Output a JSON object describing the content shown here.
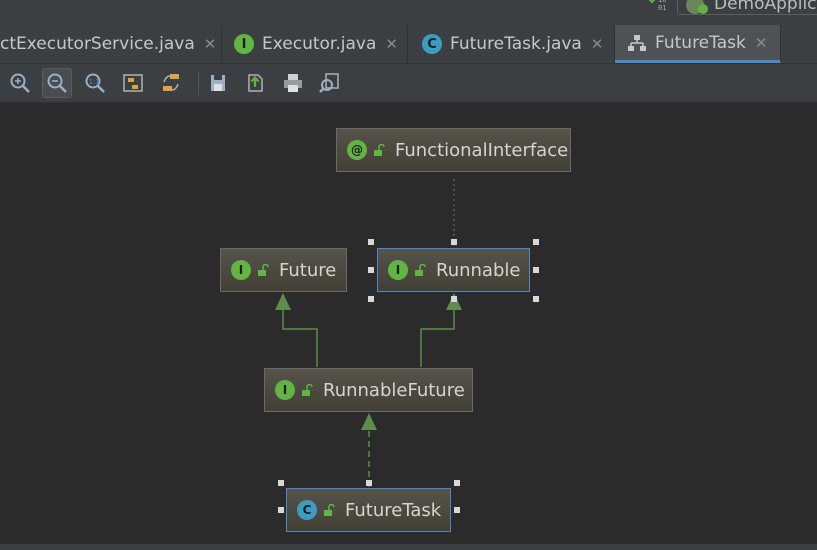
{
  "run_config": {
    "label": "DemoApplic"
  },
  "tabs": [
    {
      "label": "ctExecutorService.java",
      "icon": "none",
      "active": false
    },
    {
      "label": "Executor.java",
      "icon": "interface-I-icon",
      "active": false
    },
    {
      "label": "FutureTask.java",
      "icon": "class-C-icon",
      "active": false
    },
    {
      "label": "FutureTask",
      "icon": "hierarchy-icon",
      "active": true
    }
  ],
  "toolbar": {
    "buttons": [
      "zoom-in-icon",
      "zoom-out-icon",
      "actual-size-icon",
      "fit-content-icon",
      "apply-layout-icon",
      "save-icon",
      "export-icon",
      "print-icon",
      "preview-icon"
    ]
  },
  "diagram": {
    "nodes": [
      {
        "id": "functional-interface",
        "label": "FunctionalInterface",
        "kind": "annotation",
        "badge": "@"
      },
      {
        "id": "future",
        "label": "Future",
        "kind": "interface",
        "badge": "I"
      },
      {
        "id": "runnable",
        "label": "Runnable",
        "kind": "interface",
        "badge": "I",
        "selected": true
      },
      {
        "id": "runnable-future",
        "label": "RunnableFuture",
        "kind": "interface",
        "badge": "I"
      },
      {
        "id": "future-task",
        "label": "FutureTask",
        "kind": "class",
        "badge": "C",
        "selected": true
      }
    ],
    "edges": [
      {
        "from": "runnable",
        "to": "functional-interface",
        "style": "dotted"
      },
      {
        "from": "runnable-future",
        "to": "future",
        "style": "extends"
      },
      {
        "from": "runnable-future",
        "to": "runnable",
        "style": "extends"
      },
      {
        "from": "future-task",
        "to": "runnable-future",
        "style": "implements"
      }
    ]
  },
  "colors": {
    "background": "#2b2b2b",
    "node_fill": "#4a473d",
    "selection": "#4a88c7",
    "edge": "#5f8c4a",
    "interface_badge": "#62b543",
    "class_badge": "#3c9dc1"
  }
}
